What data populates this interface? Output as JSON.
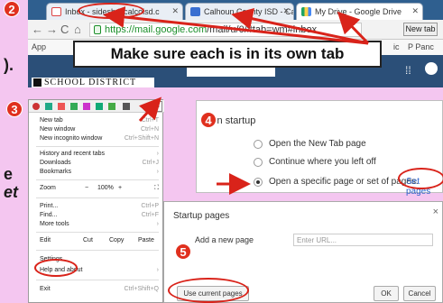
{
  "left_fragments": [
    ").",
    "e",
    "et"
  ],
  "badges": [
    "2",
    "3",
    "4",
    "5"
  ],
  "browser": {
    "tabs": [
      {
        "title": "Inbox - sidesb@calcoisd.c",
        "icon": "gmail-icon"
      },
      {
        "title": "Calhoun County ISD - Cal",
        "icon": "calendar-icon"
      },
      {
        "title": "My Drive - Google Drive",
        "icon": "drive-icon"
      }
    ],
    "url_host": "https://mail.google.com",
    "url_path": "/mail/u/0/#tab=wm#inbox",
    "new_tab_button": "New tab",
    "bookmarks": [
      "App",
      "ic",
      "P Panc"
    ],
    "school_banner": "SCHOOL DISTRICT"
  },
  "callout": "Make sure each is in its own tab",
  "menu": {
    "items": [
      {
        "label": "New tab",
        "shortcut": "Ctrl+T"
      },
      {
        "label": "New window",
        "shortcut": "Ctrl+N"
      },
      {
        "label": "New incognito window",
        "shortcut": "Ctrl+Shift+N"
      },
      {
        "label": "History and recent tabs",
        "shortcut": "›"
      },
      {
        "label": "Downloads",
        "shortcut": "Ctrl+J"
      },
      {
        "label": "Bookmarks",
        "shortcut": "›"
      },
      {
        "label": "Print...",
        "shortcut": "Ctrl+P"
      },
      {
        "label": "Find...",
        "shortcut": "Ctrl+F"
      },
      {
        "label": "More tools",
        "shortcut": "›"
      },
      {
        "label": "Settings",
        "shortcut": ""
      },
      {
        "label": "Help and about",
        "shortcut": "›"
      },
      {
        "label": "Exit",
        "shortcut": "Ctrl+Shift+Q"
      }
    ],
    "zoom": {
      "label": "Zoom",
      "minus": "−",
      "value": "100%",
      "plus": "+",
      "full": "⛶"
    },
    "edit": {
      "label": "Edit",
      "cut": "Cut",
      "copy": "Copy",
      "paste": "Paste"
    }
  },
  "startup": {
    "heading": "On startup",
    "options": [
      "Open the New Tab page",
      "Continue where you left off",
      "Open a specific page or set of pages."
    ],
    "selected_index": 2,
    "set_pages_link": "Set pages"
  },
  "dialog": {
    "title": "Startup pages",
    "add_label": "Add a new page",
    "input_placeholder": "Enter URL...",
    "use_current": "Use current pages",
    "ok": "OK",
    "cancel": "Cancel",
    "close": "×"
  },
  "colors": {
    "background": "#f4c6f0",
    "annotation_red": "#d9231a",
    "link_blue": "#2a62c9"
  }
}
